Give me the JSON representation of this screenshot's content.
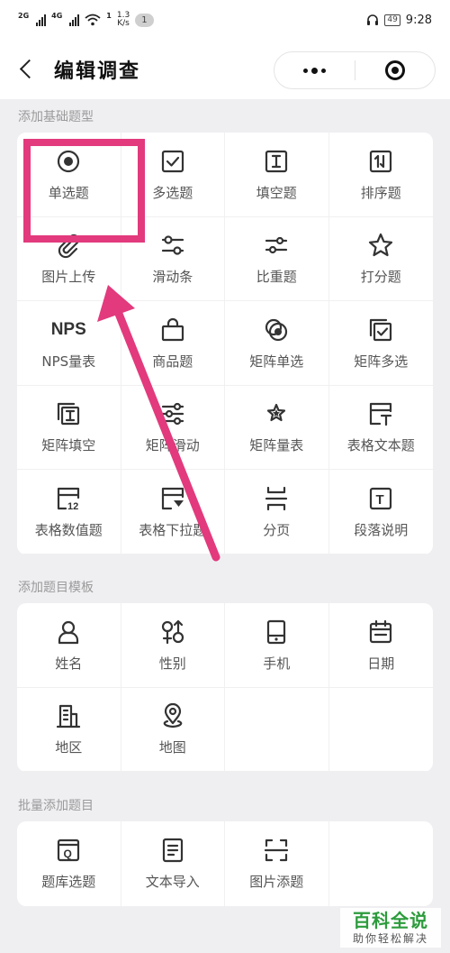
{
  "status_bar": {
    "signal_1": "2G",
    "signal_2": "4G",
    "data_sup": "1",
    "speed_value": "1.3",
    "speed_unit": "K/s",
    "notification_count": "1",
    "battery": "49",
    "time": "9:28"
  },
  "nav": {
    "title": "编辑调查"
  },
  "sections": {
    "basic": "添加基础题型",
    "template": "添加题目模板",
    "batch": "批量添加题目"
  },
  "basic_items": [
    {
      "label": "单选题",
      "icon": "radio-icon"
    },
    {
      "label": "多选题",
      "icon": "checkbox-icon"
    },
    {
      "label": "填空题",
      "icon": "text-cursor-icon"
    },
    {
      "label": "排序题",
      "icon": "sort-icon"
    },
    {
      "label": "图片上传",
      "icon": "paperclip-icon"
    },
    {
      "label": "滑动条",
      "icon": "slider-icon"
    },
    {
      "label": "比重题",
      "icon": "weight-slider-icon"
    },
    {
      "label": "打分题",
      "icon": "star-icon"
    },
    {
      "label": "NPS量表",
      "icon": "nps-icon",
      "icon_text": "NPS"
    },
    {
      "label": "商品题",
      "icon": "shopping-bag-icon"
    },
    {
      "label": "矩阵单选",
      "icon": "matrix-radio-icon"
    },
    {
      "label": "矩阵多选",
      "icon": "matrix-checkbox-icon"
    },
    {
      "label": "矩阵填空",
      "icon": "matrix-text-icon"
    },
    {
      "label": "矩阵滑动",
      "icon": "matrix-slider-icon"
    },
    {
      "label": "矩阵量表",
      "icon": "matrix-stars-icon"
    },
    {
      "label": "表格文本题",
      "icon": "table-text-icon"
    },
    {
      "label": "表格数值题",
      "icon": "table-number-icon",
      "icon_text": "12"
    },
    {
      "label": "表格下拉题",
      "icon": "table-dropdown-icon"
    },
    {
      "label": "分页",
      "icon": "page-break-icon"
    },
    {
      "label": "段落说明",
      "icon": "paragraph-icon",
      "icon_text": "T"
    }
  ],
  "template_items": [
    {
      "label": "姓名",
      "icon": "person-icon"
    },
    {
      "label": "性别",
      "icon": "gender-icon"
    },
    {
      "label": "手机",
      "icon": "phone-icon"
    },
    {
      "label": "日期",
      "icon": "calendar-icon"
    },
    {
      "label": "地区",
      "icon": "building-icon"
    },
    {
      "label": "地图",
      "icon": "map-pin-icon"
    }
  ],
  "batch_items": [
    {
      "label": "题库选题",
      "icon": "question-bank-icon",
      "icon_text": "Q"
    },
    {
      "label": "文本导入",
      "icon": "document-icon"
    },
    {
      "label": "图片添题",
      "icon": "scan-icon"
    }
  ],
  "watermark": {
    "title": "百科全说",
    "subtitle": "助你轻松解决"
  },
  "colors": {
    "highlight": "#e23a7d",
    "watermark_green": "#2c9b3c",
    "background": "#efeff2"
  }
}
